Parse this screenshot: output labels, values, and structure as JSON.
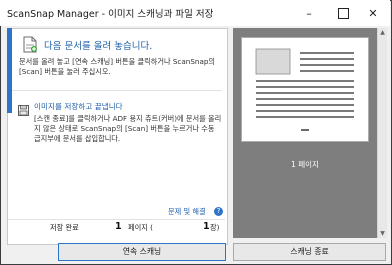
{
  "window": {
    "title": "ScanSnap Manager - 이미지 스캐닝과 파일 저장",
    "minimize": "–",
    "close": "✕"
  },
  "step1": {
    "heading": "다음 문서를 올려 놓습니다.",
    "description": "문서를 올려 놓고 [연속 스캐닝] 버튼을 클릭하거나 ScanSnap의 [Scan] 버튼을 눌러 주십시오."
  },
  "step2": {
    "heading": "이미지를 저장하고 끝냅니다",
    "description": "[스캔 종료]를 클릭하거나 ADF 용지 츄트(커버)에 문서를 올리지 않은 상태로 ScanSnap의 [Scan] 버튼을 누르거나 수동 급지부에 문서를 삽입합니다."
  },
  "help": {
    "link": "문제 및 해결",
    "icon": "?"
  },
  "status": {
    "label": "저장 완료",
    "count": "1",
    "unit": "페이지 (",
    "total": "1",
    "close": "장)"
  },
  "preview": {
    "page_label": "1 페이지"
  },
  "buttons": {
    "continue_scan": "연속 스캐닝",
    "finish_scan": "스캐닝 종료"
  },
  "colors": {
    "accent": "#2e75c9",
    "preview_bg": "#7e7e7e"
  },
  "icons": {
    "document": "document-add-icon",
    "save": "save-icon",
    "help": "help-icon"
  }
}
